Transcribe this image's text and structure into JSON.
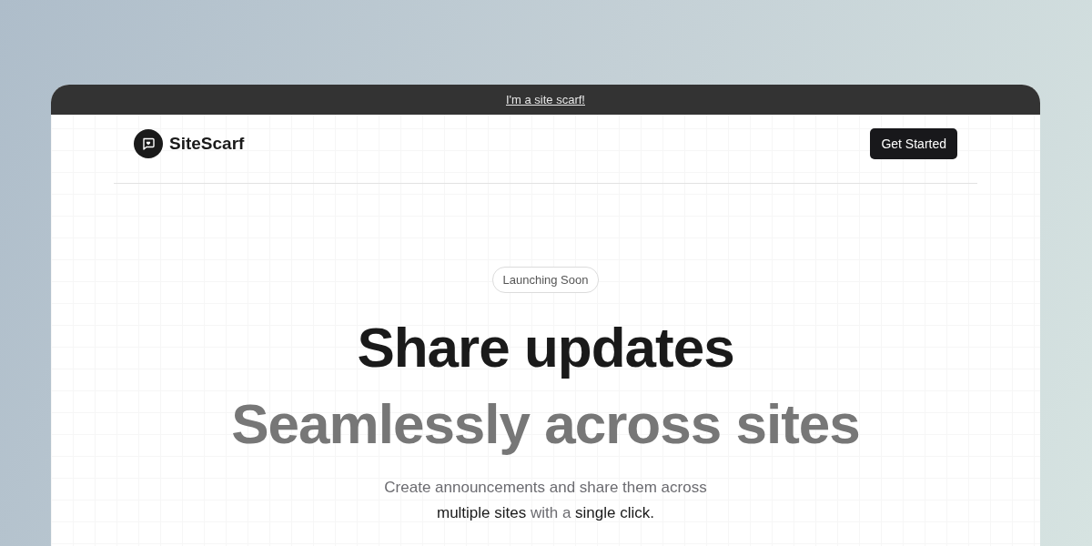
{
  "banner": {
    "link": "I'm a site scarf!"
  },
  "nav": {
    "brand": "SiteScarf",
    "button": "Get Started"
  },
  "hero": {
    "badge": "Launching Soon",
    "title": "Share updates",
    "subtitle": "Seamlessly across sites",
    "description": "Create announcements and share them across **multiple sites** with a **single click.**"
  }
}
